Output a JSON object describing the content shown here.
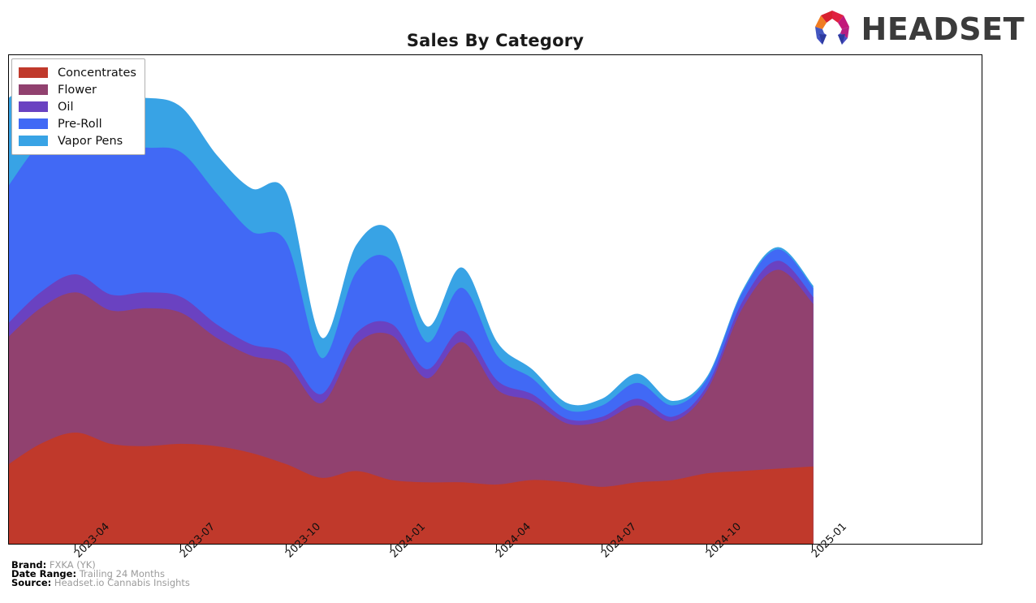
{
  "header": {
    "title": "Sales By Category",
    "logo_text": "HEADSET",
    "logo_icon": "headset-polygon-logo"
  },
  "legend": {
    "position": "top-left",
    "items": [
      {
        "label": "Concentrates",
        "color": "#c0392b"
      },
      {
        "label": "Flower",
        "color": "#91416f"
      },
      {
        "label": "Oil",
        "color": "#6a42c1"
      },
      {
        "label": "Pre-Roll",
        "color": "#4169f5"
      },
      {
        "label": "Vapor Pens",
        "color": "#38a3e5"
      }
    ]
  },
  "footer": {
    "brand_key": "Brand:",
    "brand_value": "FXKA (YK)",
    "date_range_key": "Date Range:",
    "date_range_value": "Trailing 24 Months",
    "source_key": "Source:",
    "source_value": "Headset.io Cannabis Insights"
  },
  "chart_data": {
    "type": "area",
    "title": "Sales By Category",
    "xlabel": "",
    "ylabel": "",
    "stacked": true,
    "grid": false,
    "legend_position": "top-left",
    "axis": {
      "x_tick_labels": [
        "2023-04",
        "2023-07",
        "2023-10",
        "2024-01",
        "2024-04",
        "2024-07",
        "2024-10",
        "2025-01"
      ],
      "x_tick_fractions": [
        0.0685,
        0.1766,
        0.2846,
        0.3927,
        0.5008,
        0.6089,
        0.717,
        0.8251
      ],
      "y_tick_labels": [],
      "ylim": [
        0,
        100
      ]
    },
    "x": [
      "2023-02",
      "2023-03",
      "2023-04",
      "2023-05",
      "2023-06",
      "2023-07",
      "2023-08",
      "2023-09",
      "2023-10",
      "2023-11",
      "2023-12",
      "2024-01",
      "2024-02",
      "2024-03",
      "2024-04",
      "2024-05",
      "2024-06",
      "2024-07",
      "2024-08",
      "2024-09",
      "2024-10",
      "2024-11",
      "2024-12",
      "2025-01"
    ],
    "series": [
      {
        "name": "Concentrates",
        "color": "#c0392b",
        "values": [
          17.0,
          22.0,
          24.5,
          22.0,
          21.5,
          22.0,
          21.5,
          20.0,
          17.5,
          14.5,
          16.0,
          14.0,
          13.5,
          13.5,
          13.0,
          14.0,
          13.5,
          12.5,
          13.5,
          14.0,
          15.5,
          16.0,
          16.5,
          17.0
        ]
      },
      {
        "name": "Flower",
        "color": "#91416f",
        "values": [
          28.0,
          30.0,
          31.0,
          29.5,
          30.5,
          29.0,
          24.0,
          21.5,
          22.0,
          16.5,
          28.0,
          32.0,
          23.0,
          31.0,
          21.0,
          17.5,
          13.0,
          14.5,
          17.0,
          13.0,
          18.5,
          36.0,
          44.0,
          36.0
        ]
      },
      {
        "name": "Oil",
        "color": "#6a42c1",
        "values": [
          3.0,
          3.5,
          4.0,
          3.5,
          3.5,
          3.5,
          3.0,
          2.5,
          2.5,
          2.0,
          2.5,
          2.5,
          2.0,
          2.5,
          2.0,
          1.5,
          1.0,
          1.0,
          1.5,
          1.0,
          1.0,
          1.5,
          2.0,
          1.5
        ]
      },
      {
        "name": "Pre-Roll",
        "color": "#4169f5",
        "values": [
          30.0,
          33.0,
          33.0,
          33.0,
          32.0,
          32.0,
          29.0,
          25.0,
          24.5,
          8.0,
          13.5,
          14.0,
          6.0,
          9.5,
          5.5,
          3.5,
          2.0,
          2.5,
          3.5,
          2.5,
          1.5,
          2.0,
          2.5,
          2.0
        ]
      },
      {
        "name": "Vapor Pens",
        "color": "#38a3e5",
        "values": [
          20.0,
          14.0,
          7.0,
          9.5,
          11.0,
          10.0,
          8.5,
          9.5,
          11.0,
          4.5,
          6.0,
          6.5,
          3.5,
          4.5,
          3.0,
          2.0,
          1.5,
          1.5,
          2.0,
          1.0,
          0.5,
          0.5,
          0.5,
          0.5
        ]
      }
    ]
  }
}
